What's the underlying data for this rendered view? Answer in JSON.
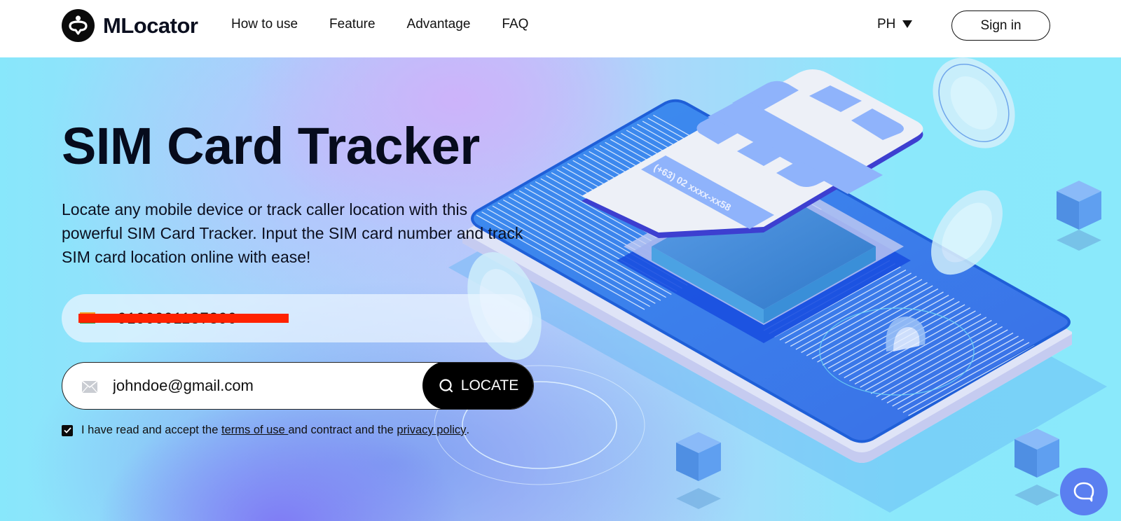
{
  "header": {
    "brand": "MLocator",
    "nav": [
      "How to use",
      "Feature",
      "Advantage",
      "FAQ"
    ],
    "language": "PH",
    "signin_label": "Sign in"
  },
  "hero": {
    "title": "SIM Card Tracker",
    "subtitle": "Locate any mobile device or track caller location with this powerful SIM Card Tracker. Input the SIM card number and track SIM card location online with ease!",
    "phone_field": {
      "country_flag": "ph-flag",
      "value": "9190001137890",
      "redacted": true
    },
    "email_field": {
      "value": "johndoe@gmail.com",
      "icon": "mail-icon"
    },
    "locate_label": "LOCATE",
    "consent": {
      "checked": true,
      "prefix": "I have read and accept the ",
      "terms_link": "terms of use ",
      "middle": "and contract and the ",
      "privacy_link": "privacy policy",
      "suffix": "."
    },
    "sim_card_text": "(+63) 02 xxxx-xx58"
  },
  "colors": {
    "primary_dark": "#000000",
    "chat_button": "#5a7ff0",
    "phone_blue": "#3b7ae8",
    "sim_chip": "#8fb3fb",
    "bg_cyan": "#8ae9fb",
    "bg_purple": "#c9b4fa"
  },
  "chat_widget": {
    "icon": "chat-bubble-icon"
  }
}
